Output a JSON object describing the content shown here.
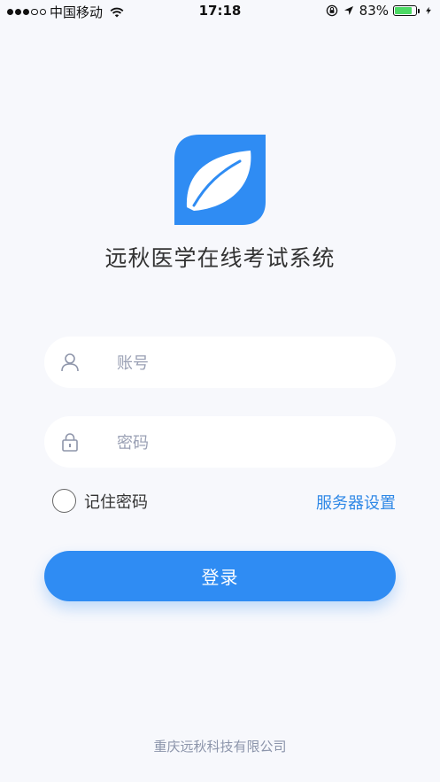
{
  "status_bar": {
    "carrier": "中国移动",
    "time": "17:18",
    "battery_percent": "83%",
    "battery_level": 0.83,
    "icons": [
      "signal-dots-icon",
      "wifi-icon",
      "rotation-lock-icon",
      "location-arrow-icon",
      "battery-icon",
      "charging-bolt-icon"
    ]
  },
  "app": {
    "title": "远秋医学在线考试系统",
    "logo_icon": "leaf-logo-icon",
    "brand_color": "#2f8cf3"
  },
  "form": {
    "account": {
      "placeholder": "账号",
      "value": "",
      "icon": "user-icon"
    },
    "password": {
      "placeholder": "密码",
      "value": "",
      "icon": "lock-icon"
    },
    "remember_label": "记住密码",
    "remember_checked": false,
    "server_settings_label": "服务器设置",
    "login_label": "登录"
  },
  "footer": {
    "company": "重庆远秋科技有限公司"
  }
}
